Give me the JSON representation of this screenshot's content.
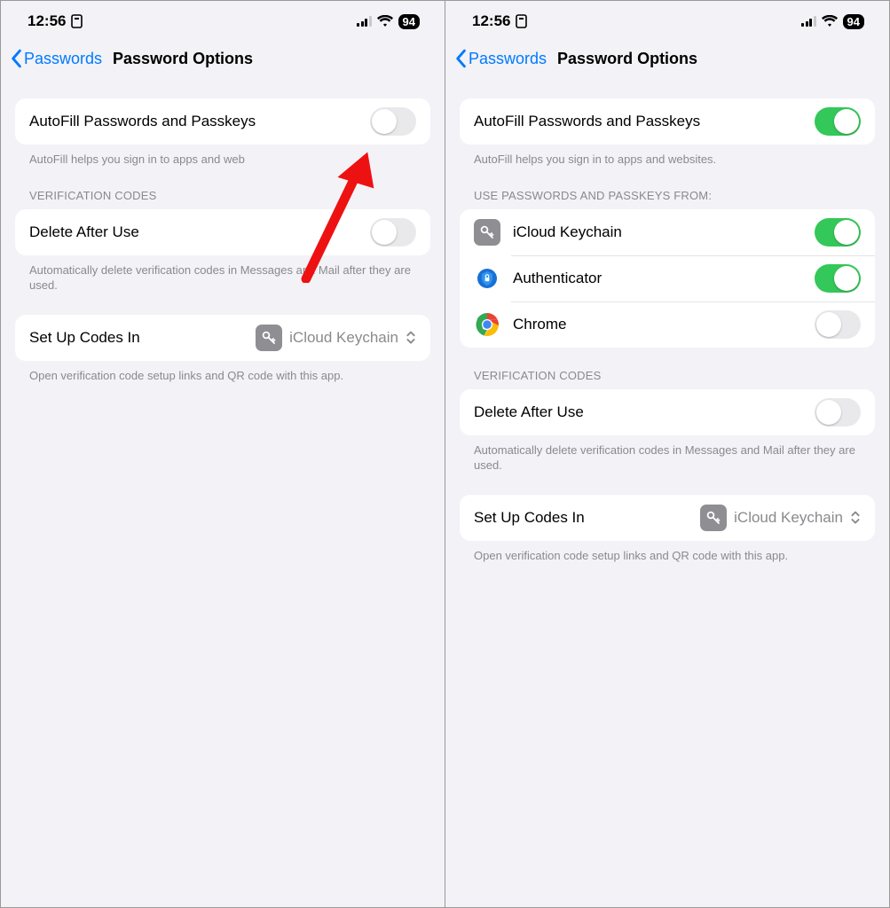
{
  "status": {
    "time": "12:56",
    "battery": "94"
  },
  "nav": {
    "back": "Passwords",
    "title": "Password Options"
  },
  "autofill": {
    "label": "AutoFill Passwords and Passkeys",
    "footer": "AutoFill helps you sign in to apps and websites."
  },
  "providers": {
    "header": "USE PASSWORDS AND PASSKEYS FROM:",
    "items": [
      {
        "name": "iCloud Keychain",
        "icon": "key",
        "on": true
      },
      {
        "name": "Authenticator",
        "icon": "authenticator",
        "on": true
      },
      {
        "name": "Chrome",
        "icon": "chrome",
        "on": false
      }
    ]
  },
  "verification": {
    "header": "VERIFICATION CODES",
    "delete_label": "Delete After Use",
    "delete_footer": "Automatically delete verification codes in Messages and Mail after they are used."
  },
  "setup": {
    "label": "Set Up Codes In",
    "value": "iCloud Keychain",
    "footer": "Open verification code setup links and QR code with this app."
  },
  "left": {
    "autofill_on": false,
    "autofill_footer_clipped": "AutoFill helps you sign in to apps and web"
  },
  "right": {
    "autofill_on": true
  }
}
